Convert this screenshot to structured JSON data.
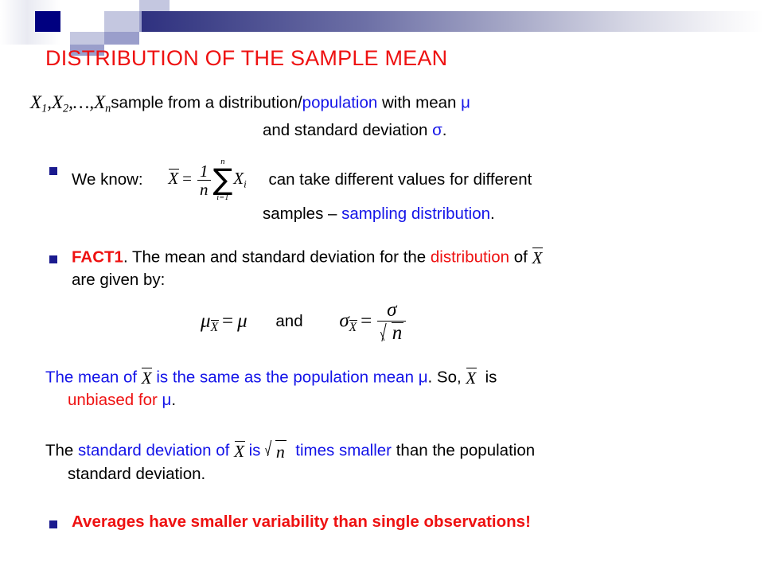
{
  "slide": {
    "title": "DISTRIBUTION OF THE SAMPLE MEAN",
    "colors": {
      "title_red": "#ee1111",
      "accent_blue": "#1414e8",
      "bullet_navy": "#1b1b8f",
      "deco_navy": "#000080",
      "body_black": "#000000"
    }
  },
  "header": {
    "decoration": "gradient-bar-with-squares"
  },
  "intro": {
    "math_sample": "X₁, X₂, …, Xₙ",
    "var_x": "X",
    "sub_1": "1",
    "sub_2": "2",
    "sub_n": "n",
    "ellipsis": ",…,",
    "comma": ",",
    "text_1": "sample from a distribution/",
    "text_population": "population",
    "text_2": "with mean",
    "mu": "μ",
    "line2_text": "and standard deviation",
    "sigma": "σ",
    "period": "."
  },
  "bullet_we_know": {
    "label": "We know:",
    "formula": {
      "xbar": "X",
      "equals": "=",
      "num": "1",
      "den": "n",
      "sum_top": "n",
      "sum_symbol": "∑",
      "sum_bottom": "i=1",
      "term": "X",
      "term_sub": "i"
    },
    "text_after": "can take different values for different",
    "line2_a": "samples –",
    "line2_b": "sampling distribution",
    "line2_c": "."
  },
  "bullet_fact1": {
    "label": "FACT1",
    "text_a": ". The mean and standard deviation for the",
    "text_distribution": "distribution",
    "text_of": "of",
    "xbar": "X",
    "text_b": "are given by:",
    "formula_mean": {
      "mu": "μ",
      "sub_xbar": "X",
      "equals": "=",
      "rhs": "μ"
    },
    "and": "and",
    "formula_sd": {
      "sigma": "σ",
      "sub_xbar": "X",
      "equals": "=",
      "num": "σ",
      "den": "n"
    }
  },
  "para_mean": {
    "a": "The mean of",
    "xbar": "X",
    "b": "is the same as the population mean",
    "mu": "μ",
    "c": ". So,",
    "xbar2": "X",
    "d": "is",
    "e": "unbiased for",
    "mu2": "μ",
    "f": "."
  },
  "para_sd": {
    "a": "The",
    "b": "standard deviation of",
    "xbar": "X",
    "c": "is",
    "sqrt_n": "n",
    "d": "times smaller",
    "e": "than the population",
    "f": "standard deviation."
  },
  "bullet_final": {
    "text": "Averages have smaller variability than single observations!"
  }
}
